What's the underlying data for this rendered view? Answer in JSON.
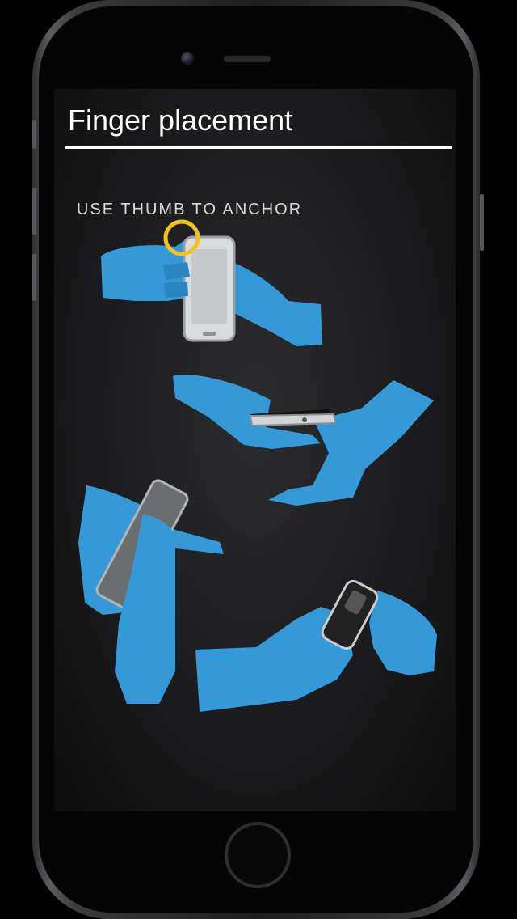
{
  "screen": {
    "title": "Finger placement",
    "instruction": "USE THUMB TO ANCHOR"
  },
  "colors": {
    "hand": "#3499d6",
    "anchor_ring": "#f0c419",
    "background": "#1f1f21",
    "title_text": "#ffffff"
  },
  "illustrations": [
    "hand-holding-phone-upright-thumb-anchor",
    "hands-holding-phone-sideways",
    "hand-holding-phone-tilted",
    "hands-holding-phone-back-view"
  ]
}
